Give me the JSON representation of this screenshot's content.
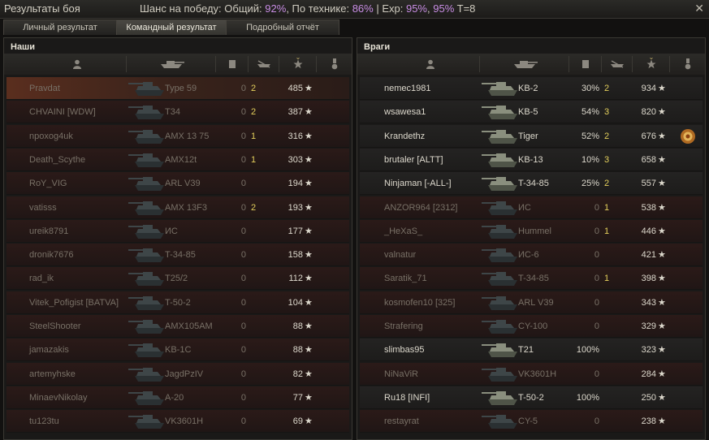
{
  "window": {
    "title": "Результаты боя",
    "win_chance_prefix": "Шанс на победу: Общий: ",
    "overall": "92%",
    "tech_prefix": ", По технике: ",
    "tech": "86%",
    "exp_prefix": " | Exp: ",
    "exp1": "95%",
    "exp_sep": ", ",
    "exp2": "95%",
    "tier": " T=8"
  },
  "tabs": [
    {
      "label": "Личный результат"
    },
    {
      "label": "Командный результат"
    },
    {
      "label": "Подробный отчёт"
    }
  ],
  "active_tab": 1,
  "colors": {
    "accent_purple": "#c88de4",
    "dead_text": "#787066",
    "alive_text": "#dcd8cc",
    "kills_yellow": "#e3cf5c"
  },
  "teams": [
    {
      "title": "Наши",
      "players": [
        {
          "name": "Pravdat",
          "tank": "Type 59",
          "spot": "0",
          "kills": "2",
          "xp": "485",
          "alive": false
        },
        {
          "name": "CHVAINI [WDW]",
          "tank": "T34",
          "spot": "0",
          "kills": "2",
          "xp": "387",
          "alive": false
        },
        {
          "name": "npoxog4uk",
          "tank": "AMX 13 75",
          "spot": "0",
          "kills": "1",
          "xp": "316",
          "alive": false
        },
        {
          "name": "Death_Scythe",
          "tank": "AMX12t",
          "spot": "0",
          "kills": "1",
          "xp": "303",
          "alive": false
        },
        {
          "name": "RoY_VIG",
          "tank": "ARL V39",
          "spot": "0",
          "kills": "",
          "xp": "194",
          "alive": false
        },
        {
          "name": "vatisss",
          "tank": "AMX 13F3",
          "spot": "0",
          "kills": "2",
          "xp": "193",
          "alive": false
        },
        {
          "name": "ureik8791",
          "tank": "ИС",
          "spot": "0",
          "kills": "",
          "xp": "177",
          "alive": false
        },
        {
          "name": "dronik7676",
          "tank": "T-34-85",
          "spot": "0",
          "kills": "",
          "xp": "158",
          "alive": false
        },
        {
          "name": "rad_ik",
          "tank": "T25/2",
          "spot": "0",
          "kills": "",
          "xp": "112",
          "alive": false
        },
        {
          "name": "Vitek_Pofigist [BATVA]",
          "tank": "T-50-2",
          "spot": "0",
          "kills": "",
          "xp": "104",
          "alive": false
        },
        {
          "name": "SteelShooter",
          "tank": "AMX105AM",
          "spot": "0",
          "kills": "",
          "xp": "88",
          "alive": false
        },
        {
          "name": "jamazakis",
          "tank": "KB-1C",
          "spot": "0",
          "kills": "",
          "xp": "88",
          "alive": false
        },
        {
          "name": "artemyhske",
          "tank": "JagdPzIV",
          "spot": "0",
          "kills": "",
          "xp": "82",
          "alive": false
        },
        {
          "name": "MinaevNikolay",
          "tank": "A-20",
          "spot": "0",
          "kills": "",
          "xp": "77",
          "alive": false
        },
        {
          "name": "tu123tu",
          "tank": "VK3601H",
          "spot": "0",
          "kills": "",
          "xp": "69",
          "alive": false
        }
      ]
    },
    {
      "title": "Враги",
      "players": [
        {
          "name": "nemec1981",
          "tank": "KB-2",
          "spot": "30%",
          "kills": "2",
          "xp": "934",
          "alive": true
        },
        {
          "name": "wsawesa1",
          "tank": "KB-5",
          "spot": "54%",
          "kills": "3",
          "xp": "820",
          "alive": true
        },
        {
          "name": "Krandethz",
          "tank": "Tiger",
          "spot": "52%",
          "kills": "2",
          "xp": "676",
          "alive": true,
          "medal": true
        },
        {
          "name": "brutaler [ALTT]",
          "tank": "KB-13",
          "spot": "10%",
          "kills": "3",
          "xp": "658",
          "alive": true
        },
        {
          "name": "Ninjaman [-ALL-]",
          "tank": "T-34-85",
          "spot": "25%",
          "kills": "2",
          "xp": "557",
          "alive": true
        },
        {
          "name": "ANZOR964 [2312]",
          "tank": "ИС",
          "spot": "0",
          "kills": "1",
          "xp": "538",
          "alive": false
        },
        {
          "name": "_HeXaS_",
          "tank": "Hummel",
          "spot": "0",
          "kills": "1",
          "xp": "446",
          "alive": false
        },
        {
          "name": "valnatur",
          "tank": "ИС-6",
          "spot": "0",
          "kills": "",
          "xp": "421",
          "alive": false
        },
        {
          "name": "Saratik_71",
          "tank": "T-34-85",
          "spot": "0",
          "kills": "1",
          "xp": "398",
          "alive": false
        },
        {
          "name": "kosmofen10 [325]",
          "tank": "ARL V39",
          "spot": "0",
          "kills": "",
          "xp": "343",
          "alive": false
        },
        {
          "name": "Strafering",
          "tank": "CY-100",
          "spot": "0",
          "kills": "",
          "xp": "329",
          "alive": false
        },
        {
          "name": "slimbas95",
          "tank": "T21",
          "spot": "100%",
          "kills": "",
          "xp": "323",
          "alive": true
        },
        {
          "name": "NiNaViR",
          "tank": "VK3601H",
          "spot": "0",
          "kills": "",
          "xp": "284",
          "alive": false
        },
        {
          "name": "Ru18 [INFI]",
          "tank": "T-50-2",
          "spot": "100%",
          "kills": "",
          "xp": "250",
          "alive": true
        },
        {
          "name": "restayrat",
          "tank": "CY-5",
          "spot": "0",
          "kills": "",
          "xp": "238",
          "alive": false
        }
      ]
    }
  ]
}
